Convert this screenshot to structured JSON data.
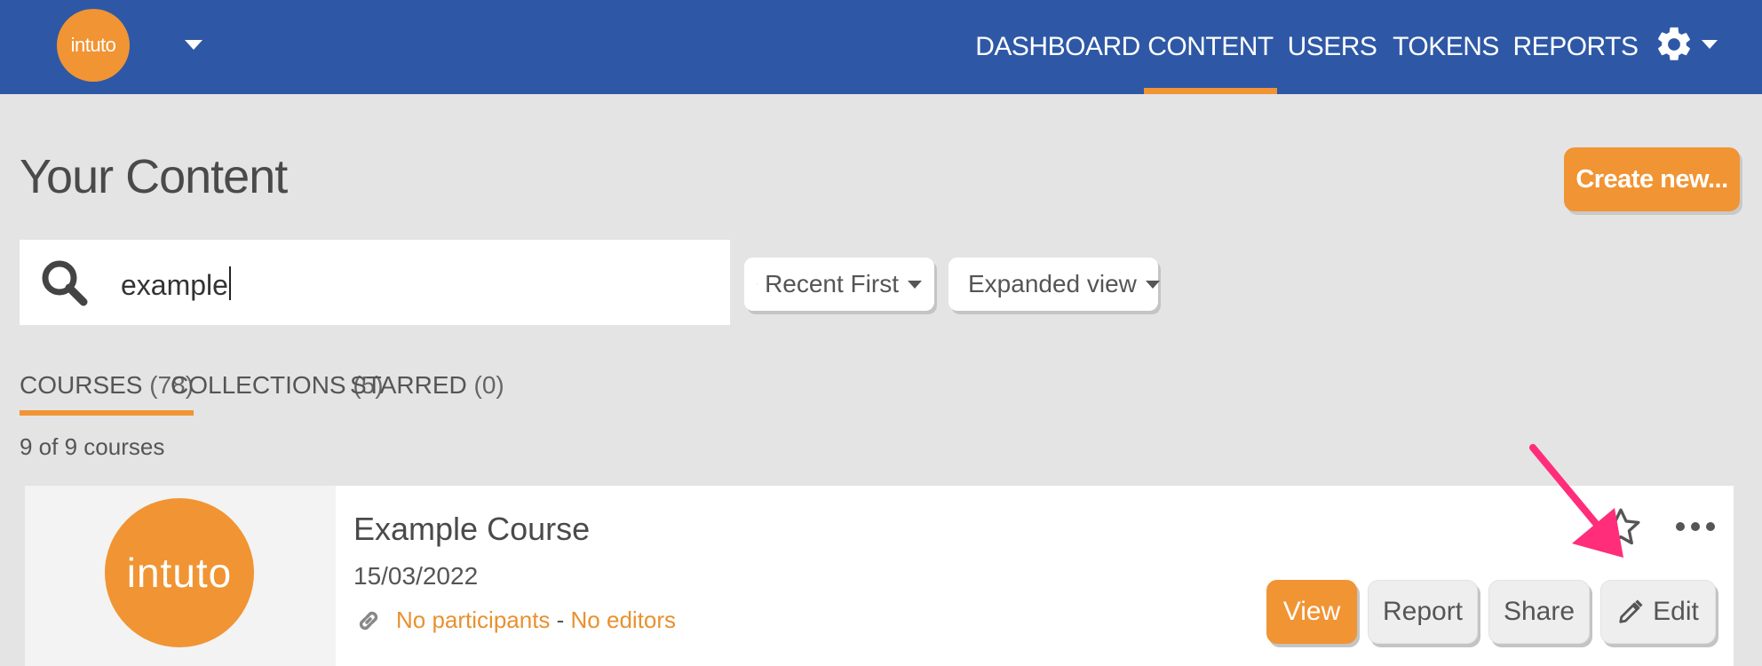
{
  "header": {
    "logo_text": "intuto",
    "nav": [
      {
        "label": "DASHBOARD",
        "active": false
      },
      {
        "label": "CONTENT",
        "active": true
      },
      {
        "label": "USERS",
        "active": false
      },
      {
        "label": "TOKENS",
        "active": false
      },
      {
        "label": "REPORTS",
        "active": false
      }
    ]
  },
  "page": {
    "title": "Your Content",
    "create_label": "Create new...",
    "search_value": "example",
    "sort_label": "Recent First",
    "view_label": "Expanded view"
  },
  "tabs": [
    {
      "label": "COURSES",
      "count": "(78)",
      "active": true
    },
    {
      "label": "COLLECTIONS",
      "count": "(5)",
      "active": false
    },
    {
      "label": "STARRED",
      "count": "(0)",
      "active": false
    }
  ],
  "results_text": "9 of 9 courses",
  "course": {
    "thumb_text": "intuto",
    "title": "Example Course",
    "date": "15/03/2022",
    "participants": "No participants",
    "separator": " - ",
    "editors": "No editors",
    "actions": {
      "view": "View",
      "report": "Report",
      "share": "Share",
      "edit": "Edit"
    }
  },
  "colors": {
    "header_bg": "#2e58a6",
    "accent": "#f19433",
    "pointer": "#ff2d7a"
  }
}
